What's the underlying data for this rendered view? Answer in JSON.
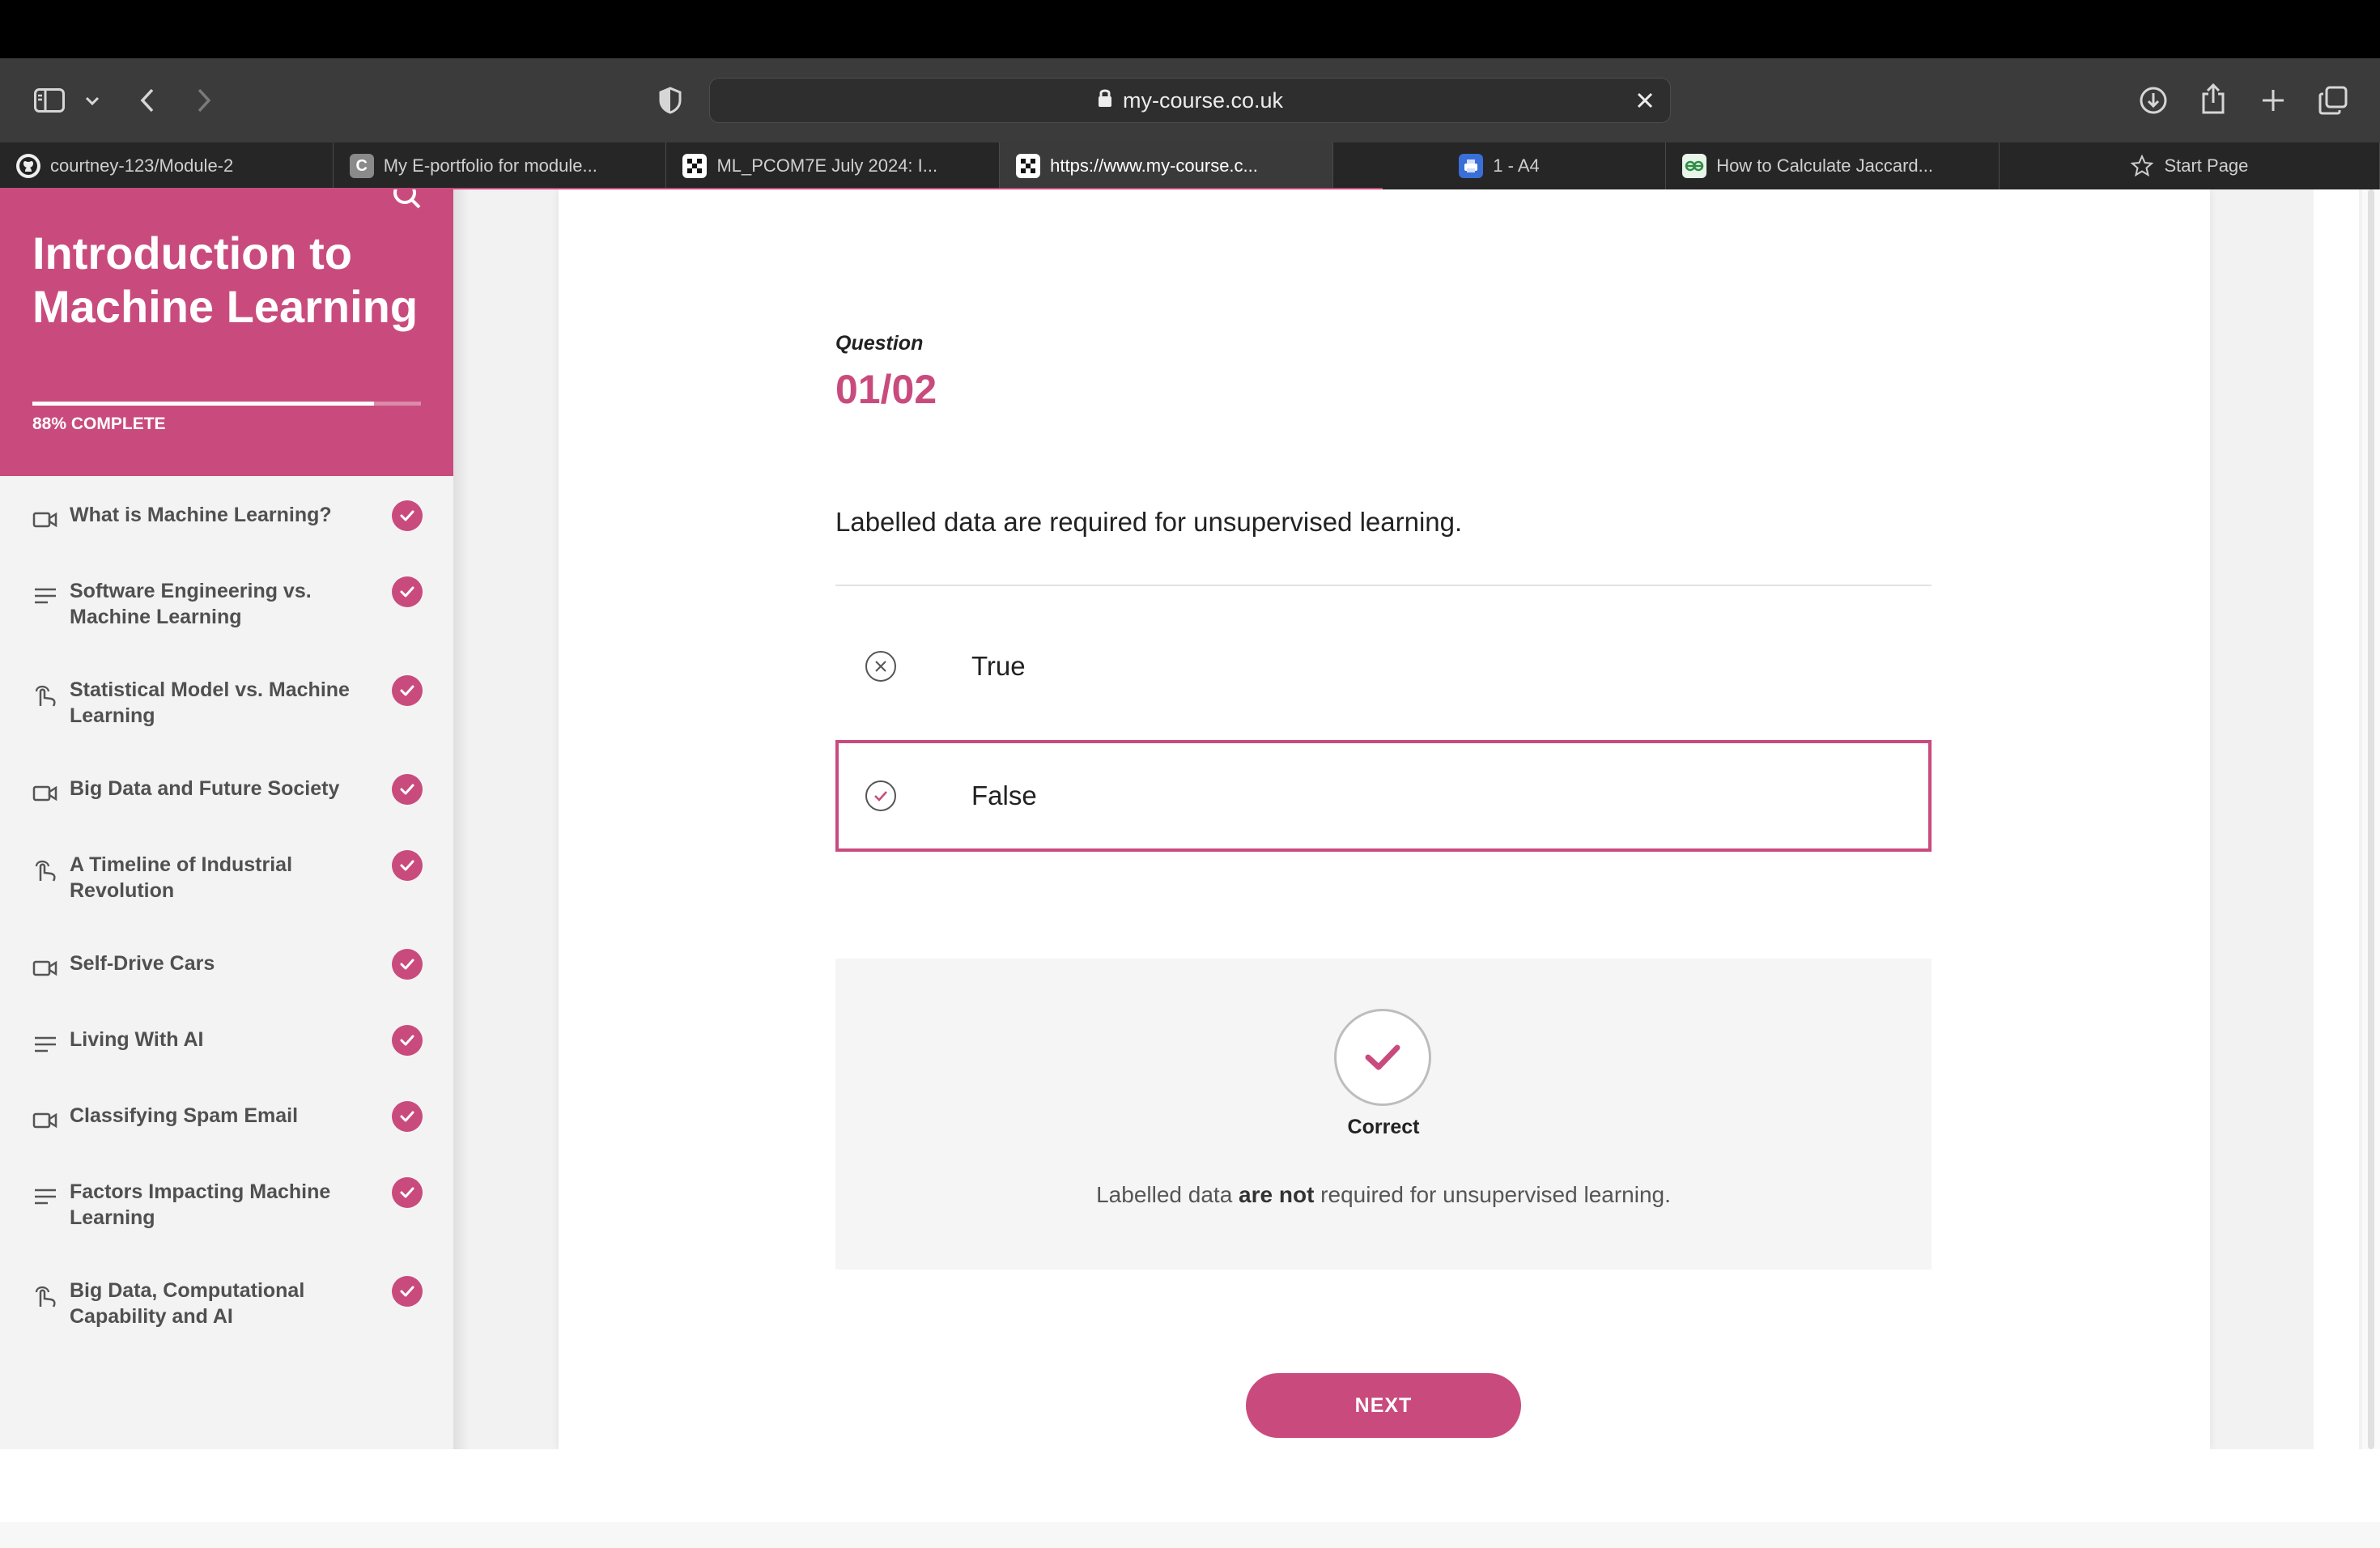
{
  "browser": {
    "url": "my-course.co.uk",
    "tabs": [
      {
        "label": "courtney-123/Module-2",
        "icon": "github-icon"
      },
      {
        "label": "My E-portfolio for module...",
        "icon": "canvas-c-icon"
      },
      {
        "label": "ML_PCOM7E July 2024: I...",
        "icon": "site-icon"
      },
      {
        "label": "https://www.my-course.c...",
        "icon": "site-icon",
        "active": true
      },
      {
        "label": "1 - A4",
        "icon": "printer-icon"
      },
      {
        "label": "How to Calculate Jaccard...",
        "icon": "geeks-icon"
      },
      {
        "label": "Start Page",
        "icon": "star-icon"
      }
    ]
  },
  "sidebar": {
    "course_title": "Introduction to Machine Learning",
    "progress_percent": 88,
    "progress_label": "88% COMPLETE",
    "lessons": [
      {
        "label": "What is Machine Learning?",
        "type": "video-icon",
        "complete": true
      },
      {
        "label": "Software Engineering vs. Machine Learning",
        "type": "text-lines-icon",
        "complete": true
      },
      {
        "label": "Statistical Model vs. Machine Learning",
        "type": "interactive-icon",
        "complete": true
      },
      {
        "label": "Big Data and Future Society",
        "type": "video-icon",
        "complete": true
      },
      {
        "label": "A Timeline of Industrial Revolution",
        "type": "interactive-icon",
        "complete": true
      },
      {
        "label": "Self-Drive Cars",
        "type": "video-icon",
        "complete": true
      },
      {
        "label": "Living With AI",
        "type": "text-lines-icon",
        "complete": true
      },
      {
        "label": "Classifying Spam Email",
        "type": "video-icon",
        "complete": true
      },
      {
        "label": "Factors Impacting Machine Learning",
        "type": "text-lines-icon",
        "complete": true
      },
      {
        "label": "Big Data, Computational Capability and AI",
        "type": "interactive-icon",
        "complete": true
      }
    ]
  },
  "quiz": {
    "question_label": "Question",
    "question_number": "01/02",
    "question_text": "Labelled data are required for unsupervised learning.",
    "options": [
      {
        "label": "True",
        "state": "incorrect",
        "selected": false
      },
      {
        "label": "False",
        "state": "correct",
        "selected": true
      }
    ],
    "feedback": {
      "status": "Correct",
      "text_before": "Labelled data ",
      "text_bold": "are not",
      "text_after": " required for unsupervised learning."
    },
    "next_label": "NEXT"
  },
  "colors": {
    "accent": "#c94b7d"
  }
}
